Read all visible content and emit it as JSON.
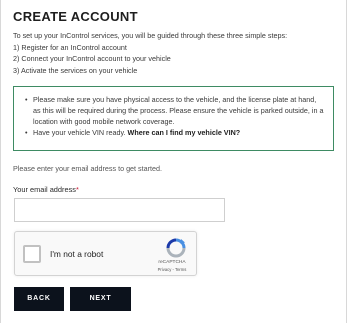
{
  "header": {
    "title": "CREATE ACCOUNT"
  },
  "intro": {
    "lead": "To set up your InControl services, you will be guided through these three simple steps:",
    "steps": [
      "1) Register for an InControl account",
      "2) Connect your InControl account to your vehicle",
      "3) Activate the services on your vehicle"
    ]
  },
  "notice": {
    "border_color": "#3e8b63",
    "bullet_1": "Please make sure you have physical access to the vehicle, and the license plate at hand, as this will be required during the process. Please ensure the vehicle is parked outside, in a location with good mobile network coverage.",
    "bullet_2_text": "Have your vehicle VIN ready.",
    "bullet_2_link": "Where can I find my vehicle VIN?"
  },
  "form": {
    "prompt": "Please enter your email address to get started.",
    "email_label": "Your email address",
    "email_required_mark": "*",
    "email_value": "",
    "email_placeholder": ""
  },
  "recaptcha": {
    "label": "I'm not a robot",
    "brand": "reCAPTCHA",
    "links": "Privacy - Terms",
    "logo_icon": "recaptcha-logo-icon"
  },
  "actions": {
    "back_label": "BACK",
    "next_label": "NEXT",
    "button_color": "#0c121c"
  }
}
